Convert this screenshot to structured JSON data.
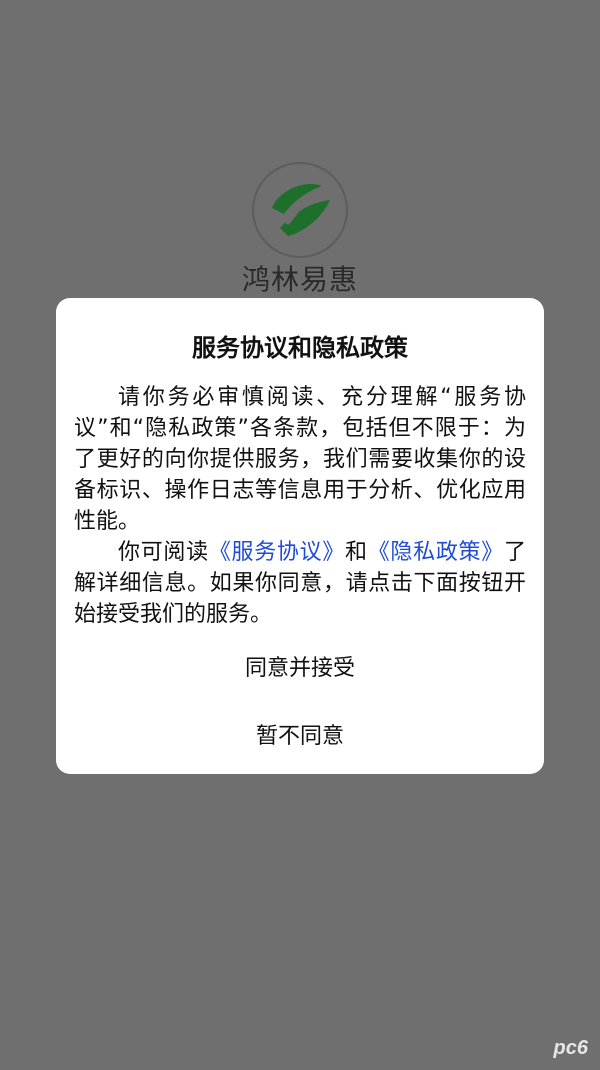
{
  "splash": {
    "app_name": "鸿林易惠",
    "logo_icon": "leaf-logo-icon",
    "logo_color": "#1f6f2c"
  },
  "dialog": {
    "title": "服务协议和隐私政策",
    "paragraph1": "请你务必审慎阅读、充分理解“服务协议”和“隐私政策”各条款，包括但不限于：为了更好的向你提供服务，我们需要收集你的设备标识、操作日志等信息用于分析、优化应用性能。",
    "paragraph2_before": "你可阅读",
    "service_link": "《服务协议》",
    "paragraph2_and": "和",
    "privacy_link": "《隐私政策》",
    "paragraph2_after": "了解详细信息。如果你同意，请点击下面按钮开始接受我们的服务。",
    "agree_button": "同意并接受",
    "decline_button": "暂不同意",
    "link_color": "#1f4bd8"
  },
  "watermark": "pc6"
}
